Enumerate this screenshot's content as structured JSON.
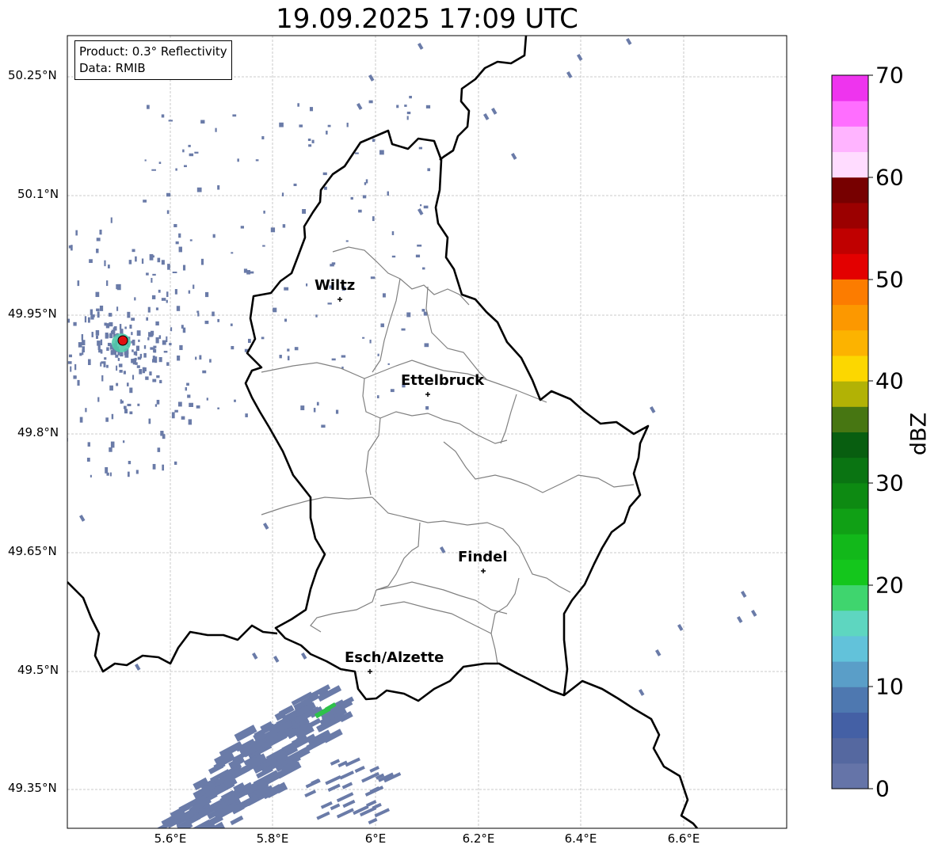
{
  "title": "19.09.2025 17:09 UTC",
  "info": {
    "product": "Product: 0.3° Reflectivity",
    "data_source": "Data: RMIB"
  },
  "axes": {
    "lat_labels": [
      "50.25°N",
      "50.1°N",
      "49.95°N",
      "49.8°N",
      "49.65°N",
      "49.5°N",
      "49.35°N"
    ],
    "lon_labels": [
      "5.6°E",
      "5.8°E",
      "6°E",
      "6.2°E",
      "6.4°E",
      "6.6°E"
    ]
  },
  "cities": [
    {
      "name": "Wiltz"
    },
    {
      "name": "Ettelbruck"
    },
    {
      "name": "Findel"
    },
    {
      "name": "Esch/Alzette"
    }
  ],
  "colorbar": {
    "label": "dBZ",
    "ticks": [
      "0",
      "10",
      "20",
      "30",
      "40",
      "50",
      "60",
      "70"
    ],
    "range": [
      0,
      70
    ],
    "colors": [
      "#6574a8",
      "#5568a0",
      "#4460a5",
      "#4e78b0",
      "#5a9ec8",
      "#62c2da",
      "#5ed6c0",
      "#3fd56e",
      "#14c61c",
      "#12b81a",
      "#10a015",
      "#0d8a12",
      "#0a7412",
      "#085e10",
      "#477612",
      "#b2b205",
      "#fcd700",
      "#fcb300",
      "#fc9800",
      "#fc7c00",
      "#e30000",
      "#c00000",
      "#9b0000",
      "#770000",
      "#ffdcff",
      "#ffb4ff",
      "#ff6eff",
      "#ee34ee"
    ]
  },
  "radar_marker_color": "#e01010",
  "echo_color": "#6a7ba8",
  "strong_echo_color": "#2ec14b"
}
